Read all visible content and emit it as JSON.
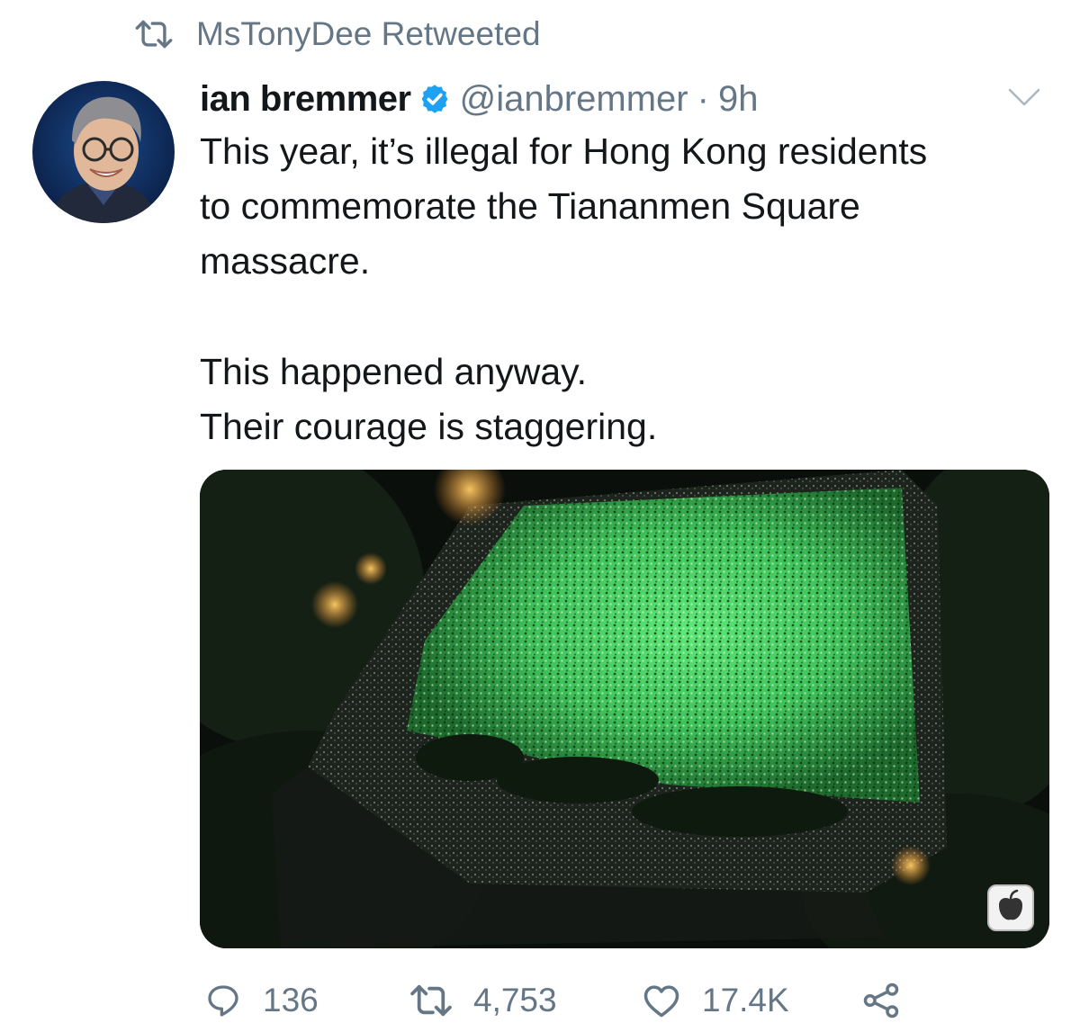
{
  "social_context": {
    "icon": "retweet-icon",
    "text": "MsTonyDee Retweeted"
  },
  "tweet": {
    "author_name": "ian bremmer",
    "verified": true,
    "handle": "@ianbremmer",
    "separator": "·",
    "time": "9h",
    "text_lines": {
      "line1": "This year, it’s illegal for Hong Kong residents",
      "line2": "to commemorate the Tiananmen Square",
      "line3": "massacre.",
      "line4": "This happened anyway.",
      "line5": "Their courage is staggering."
    },
    "media_icon": "apple-daily-logo-icon"
  },
  "actions": {
    "reply_count": "136",
    "retweet_count": "4,753",
    "like_count": "17.4K"
  },
  "colors": {
    "primary_text": "#14171a",
    "secondary_text": "#657786",
    "verified_blue": "#1da1f2",
    "vigil_green": "#3fc25a"
  }
}
